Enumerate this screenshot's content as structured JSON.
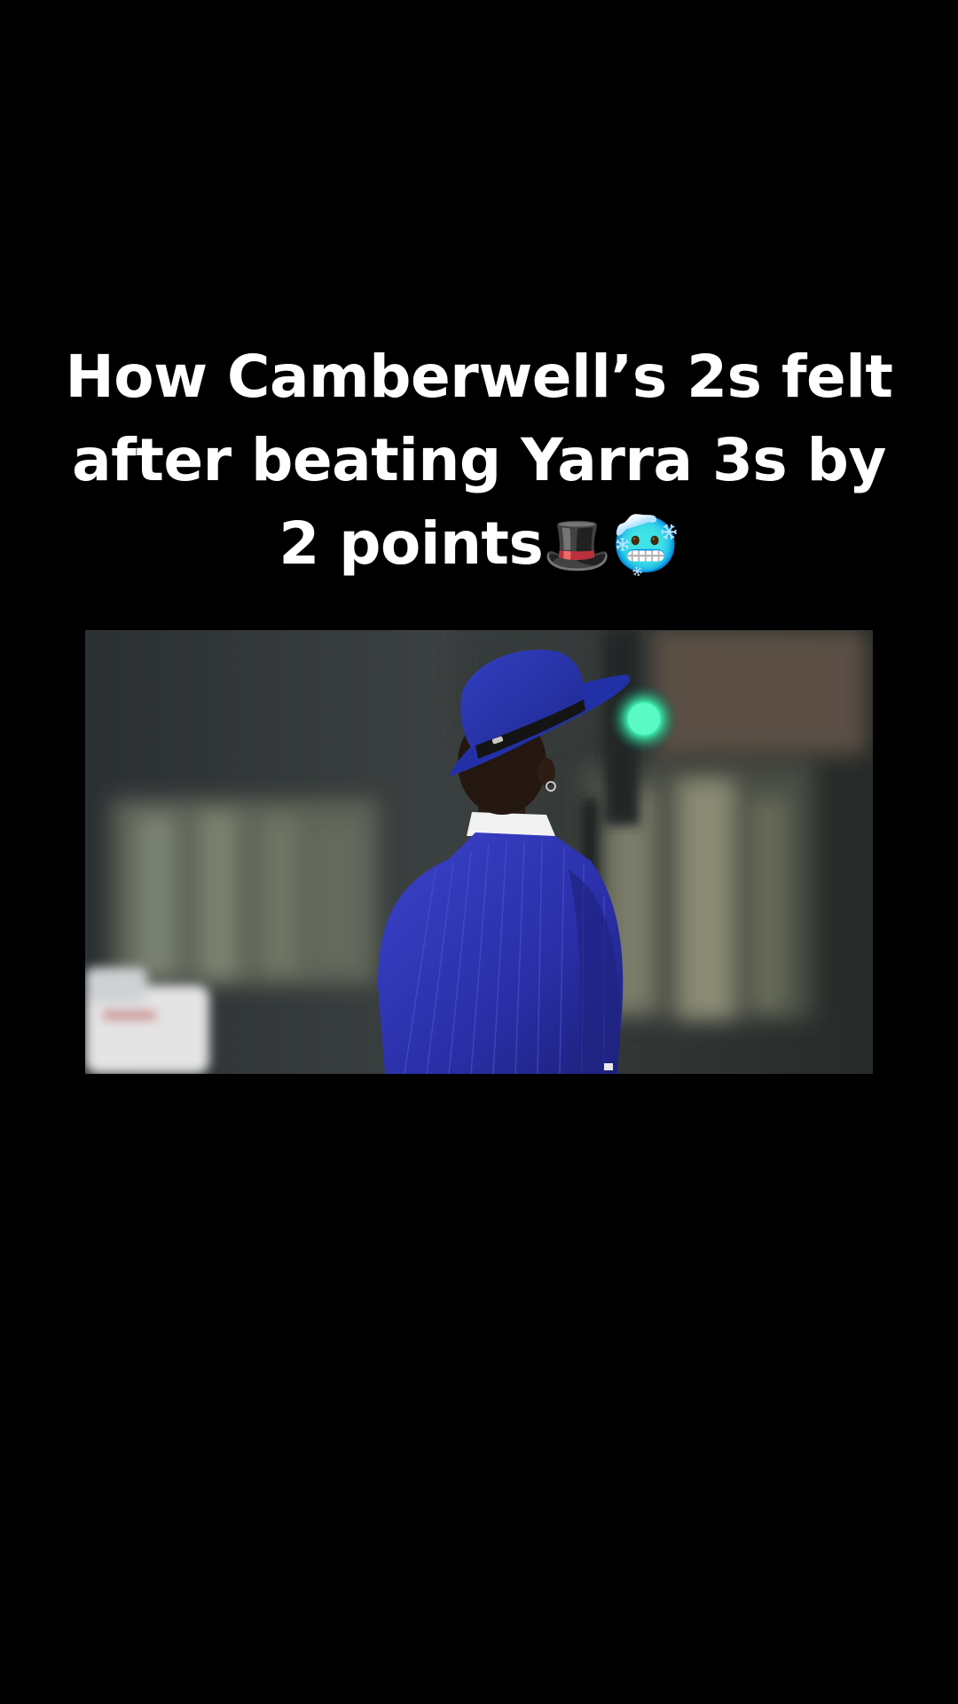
{
  "caption": {
    "line1": "How Camberwell’s 2s felt",
    "line2": "after beating Yarra  3s by",
    "line3": "2 points",
    "emoji1": "🎩",
    "emoji2": "🥶"
  },
  "scene": {
    "subject": "man-in-blue-suit-and-hat",
    "background_colors": {
      "sky": "#3a3f44",
      "building": "#5c6256",
      "light_green": "#39f5b0",
      "suit": "#2a2fa8",
      "hat": "#2530a0"
    }
  }
}
